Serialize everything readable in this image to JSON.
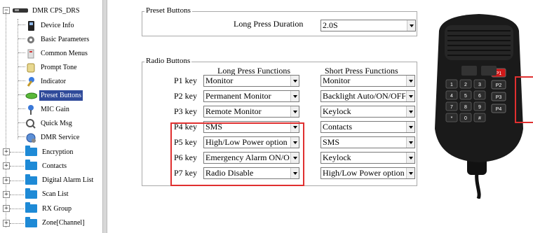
{
  "tree": {
    "root": "DMR CPS_DRS",
    "items": [
      {
        "label": "Device Info",
        "icon": "radio-device-icon"
      },
      {
        "label": "Basic Parameters",
        "icon": "gear-icon"
      },
      {
        "label": "Common Menus",
        "icon": "menu-icon"
      },
      {
        "label": "Prompt Tone",
        "icon": "scroll-icon"
      },
      {
        "label": "Indicator",
        "icon": "pencil-indicator-icon"
      },
      {
        "label": "Preset Buttons",
        "icon": "green-button-icon",
        "selected": true
      },
      {
        "label": "MIC Gain",
        "icon": "microphone-icon"
      },
      {
        "label": "Quick Msg",
        "icon": "message-icon"
      },
      {
        "label": "DMR Service",
        "icon": "globe-icon"
      }
    ],
    "folders": [
      "Encryption",
      "Contacts",
      "Digital Alarm List",
      "Scan List",
      "RX Group",
      "Zone[Channel]"
    ]
  },
  "preset": {
    "title": "Preset Buttons",
    "long_press_duration_label": "Long Press Duration",
    "long_press_duration_value": "2.0S"
  },
  "radio": {
    "title": "Radio Buttons",
    "col_long": "Long Press Functions",
    "col_short": "Short Press Functions",
    "rows": [
      {
        "key": "P1 key",
        "long": "Monitor",
        "short": "Monitor"
      },
      {
        "key": "P2 key",
        "long": "Permanent Monitor",
        "short": "Backlight Auto/ON/OFF"
      },
      {
        "key": "P3 key",
        "long": "Remote Monitor",
        "short": "Keylock"
      },
      {
        "key": "P4 key",
        "long": "SMS",
        "short": "Contacts"
      },
      {
        "key": "P5 key",
        "long": "High/Low Power option",
        "short": "SMS"
      },
      {
        "key": "P6 key",
        "long": "Emergency Alarm ON/OFF",
        "short": "Keylock"
      },
      {
        "key": "P7 key",
        "long": "Radio Disable",
        "short": "High/Low Power option"
      }
    ]
  },
  "mic": {
    "keypad": [
      "1",
      "2",
      "3",
      "4",
      "5",
      "6",
      "7",
      "8",
      "9",
      "*",
      "0",
      "#"
    ],
    "pkeys": [
      "P1",
      "P2",
      "P3",
      "P4"
    ],
    "colors": {
      "body": "#1a1a1a",
      "key": "#2c2c2c",
      "pkey": "#d01818",
      "highlight": "#e03030"
    }
  },
  "colors": {
    "selection": "#2f4a9a",
    "folder": "#1e8ad6",
    "highlight": "#e03030"
  }
}
